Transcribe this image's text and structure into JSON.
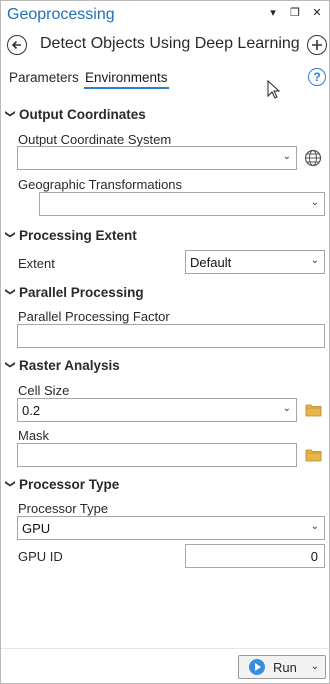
{
  "window": {
    "title": "Geoprocessing",
    "controls": [
      "▾",
      "❐",
      "✕"
    ]
  },
  "tool": {
    "title": "Detect Objects Using Deep Learning",
    "back_icon": "back-arrow-icon",
    "add_icon": "add-icon"
  },
  "tabs": {
    "parameters": "Parameters",
    "environments": "Environments",
    "active": "Environments",
    "help_label": "?"
  },
  "sections": {
    "output_coordinates": {
      "heading": "Output Coordinates",
      "coord_system_label": "Output Coordinate System",
      "coord_system_value": "",
      "geo_transform_label": "Geographic Transformations",
      "geo_transform_value": ""
    },
    "processing_extent": {
      "heading": "Processing Extent",
      "extent_label": "Extent",
      "extent_value": "Default"
    },
    "parallel_processing": {
      "heading": "Parallel Processing",
      "factor_label": "Parallel Processing Factor",
      "factor_value": ""
    },
    "raster_analysis": {
      "heading": "Raster Analysis",
      "cell_size_label": "Cell Size",
      "cell_size_value": "0.2",
      "mask_label": "Mask",
      "mask_value": ""
    },
    "processor_type": {
      "heading": "Processor Type",
      "processor_label": "Processor Type",
      "processor_value": "GPU",
      "gpu_id_label": "GPU ID",
      "gpu_id_value": "0"
    }
  },
  "footer": {
    "run_label": "Run"
  },
  "colors": {
    "accent": "#1e6fb8",
    "tab_underline": "#2e7dd1",
    "folder": "#e8b547"
  }
}
